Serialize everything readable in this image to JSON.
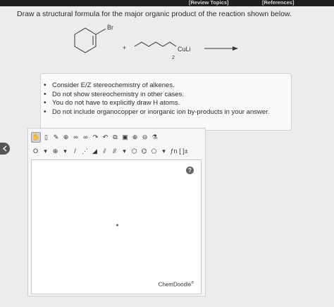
{
  "header": {
    "review_topics": "[Review Topics]",
    "references": "[References]"
  },
  "question": {
    "text": "Draw a structural formula for the major organic product of the reaction shown below."
  },
  "scheme": {
    "halide_label": "Br",
    "plus_sign": "+",
    "reagent_metal": "CuLi",
    "reagent_subscript": "2"
  },
  "notes": {
    "items": [
      "Consider E/Z stereochemistry of alkenes.",
      "Do not show stereochemistry in other cases.",
      "You do not have to explicitly draw H atoms.",
      "Do not include organocopper or inorganic ion by-products in your answer."
    ]
  },
  "editor": {
    "row1_tools": [
      "move",
      "erase",
      "pencil",
      "ring-template",
      "atom-map",
      "bracket",
      "arrow-a",
      "arrow-b",
      "copy",
      "paste",
      "zoom-in",
      "zoom-out",
      "clean"
    ],
    "row2_tools": {
      "atom_label": "O",
      "charge_label": "⊕",
      "bracket_label": "[ ]±",
      "func_label": "ƒn"
    },
    "help_label": "?",
    "brand": "ChemDoodle",
    "brand_mark": "®"
  },
  "colors": {
    "background": "#ececec",
    "topbar": "#1e1e1e",
    "panel": "#fafafa",
    "canvas": "#ffffff"
  }
}
